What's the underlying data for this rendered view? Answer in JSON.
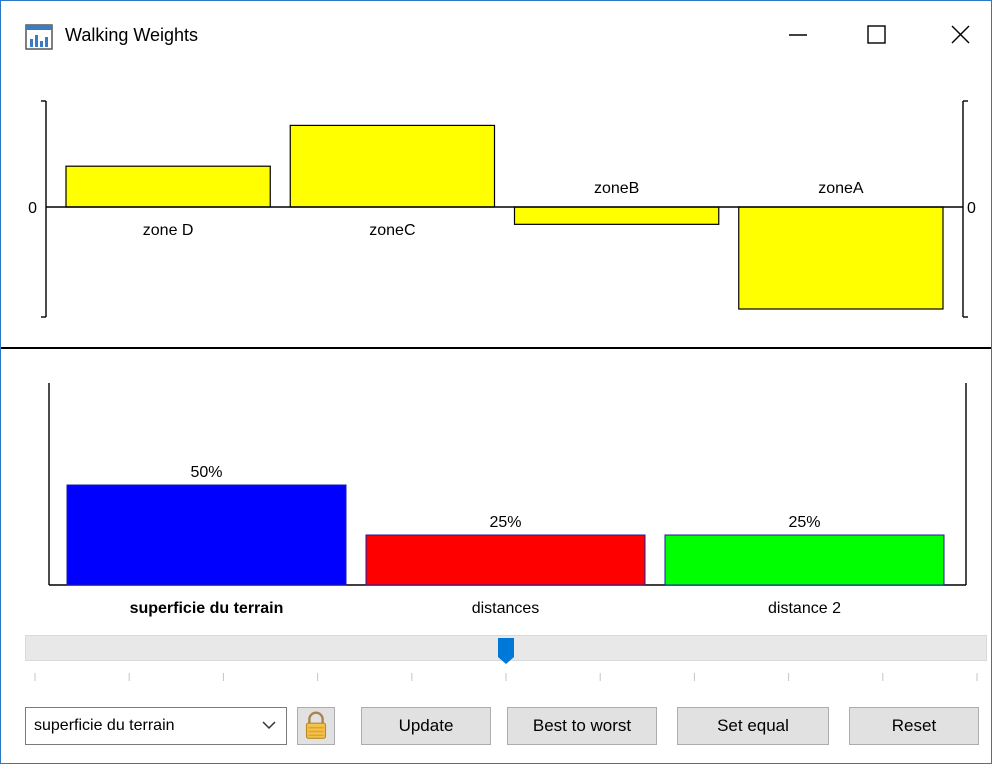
{
  "window": {
    "title": "Walking Weights",
    "icon": "chart-icon",
    "controls": [
      "minimize-icon",
      "maximize-icon",
      "close-icon"
    ]
  },
  "chart_data": [
    {
      "type": "bar",
      "title": "",
      "categories": [
        "zone D",
        "zoneC",
        "zoneB",
        "zoneA"
      ],
      "values": [
        0.4,
        0.8,
        -0.17,
        -1.0
      ],
      "baseline_label": "0",
      "ylim": [
        -1.0,
        1.05
      ],
      "bar_color": "#ffff00",
      "grid": false
    },
    {
      "type": "bar",
      "title": "",
      "categories": [
        "superficie du terrain",
        "distances",
        "distance 2"
      ],
      "values": [
        50,
        25,
        25
      ],
      "data_labels": [
        "50%",
        "25%",
        "25%"
      ],
      "colors": [
        "#0000ff",
        "#ff0000",
        "#00ff00"
      ],
      "selected_category": "superficie du terrain",
      "ylim": [
        0,
        100
      ],
      "grid": false
    }
  ],
  "slider": {
    "value": 0.5,
    "ticks": 11
  },
  "controls": {
    "criterion_select": {
      "value": "superficie du terrain"
    },
    "lock_icon": "lock-icon",
    "buttons": {
      "update": "Update",
      "best_to_worst": "Best to worst",
      "set_equal": "Set equal",
      "reset": "Reset"
    }
  }
}
